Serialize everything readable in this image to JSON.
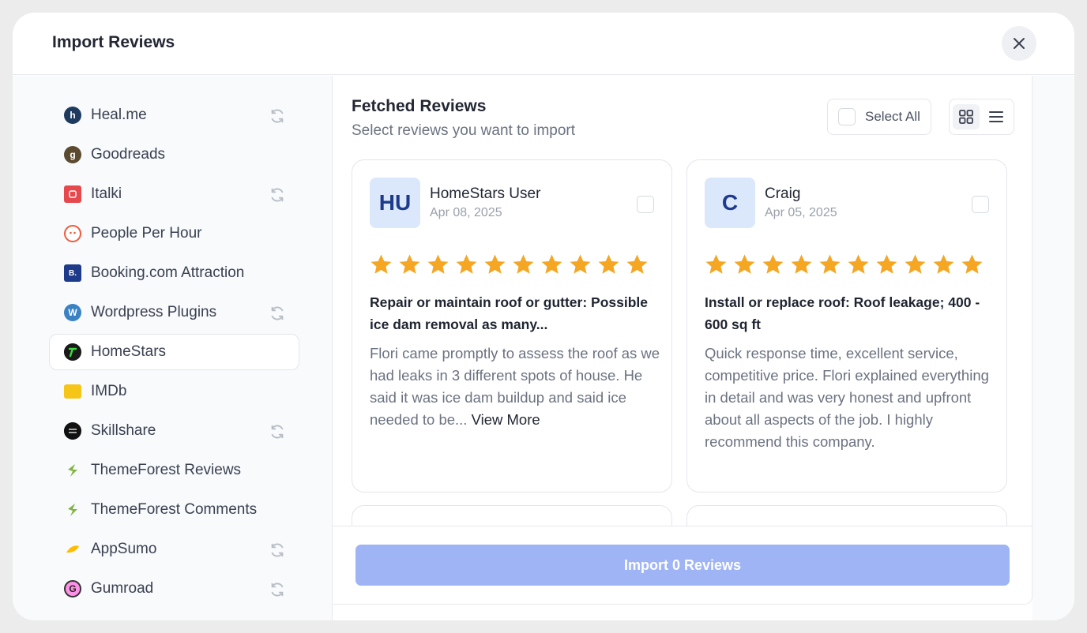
{
  "modal": {
    "title": "Import Reviews"
  },
  "sidebar": {
    "items": [
      {
        "label": "Heal.me",
        "icon": "healme-logo",
        "sync": true,
        "color": "#1e3a5f",
        "glyph": "h"
      },
      {
        "label": "Goodreads",
        "icon": "goodreads-logo",
        "sync": false,
        "color": "#5b4a2f",
        "glyph": "g"
      },
      {
        "label": "Italki",
        "icon": "italki-logo",
        "sync": true,
        "color": "#e5484d",
        "glyph": ""
      },
      {
        "label": "People Per Hour",
        "icon": "peopleperhour-logo",
        "sync": false,
        "color": "#f05a3a",
        "glyph": ""
      },
      {
        "label": "Booking.com Attraction",
        "icon": "booking-logo",
        "sync": false,
        "color": "#1e3a8a",
        "glyph": "B."
      },
      {
        "label": "Wordpress Plugins",
        "icon": "wordpress-logo",
        "sync": true,
        "color": "#3b82c4",
        "glyph": "W"
      },
      {
        "label": "HomeStars",
        "icon": "homestars-logo",
        "sync": false,
        "color": "#1a1a1a",
        "glyph": ""
      },
      {
        "label": "IMDb",
        "icon": "imdb-logo",
        "sync": false,
        "color": "#f5c518",
        "glyph": "IMDb"
      },
      {
        "label": "Skillshare",
        "icon": "skillshare-logo",
        "sync": true,
        "color": "#111111",
        "glyph": ""
      },
      {
        "label": "ThemeForest Reviews",
        "icon": "themeforest-logo",
        "sync": false,
        "color": "#82b440",
        "glyph": ""
      },
      {
        "label": "ThemeForest Comments",
        "icon": "themeforest-logo",
        "sync": false,
        "color": "#82b440",
        "glyph": ""
      },
      {
        "label": "AppSumo",
        "icon": "appsumo-logo",
        "sync": true,
        "color": "#ffbc00",
        "glyph": ""
      },
      {
        "label": "Gumroad",
        "icon": "gumroad-logo",
        "sync": true,
        "color": "#ff90e8",
        "glyph": "G"
      }
    ],
    "active_index": 6
  },
  "main": {
    "title": "Fetched Reviews",
    "subtitle": "Select reviews you want to import",
    "select_all_label": "Select All",
    "view_modes": [
      "grid",
      "list"
    ],
    "active_view": "grid"
  },
  "reviews": [
    {
      "initials": "HU",
      "name": "HomeStars User",
      "date": "Apr 08, 2025",
      "stars": 10,
      "title": "Repair or maintain roof or gutter: Possible ice dam removal as many...",
      "body": "Flori came promptly to assess the roof as we had leaks in 3 different spots of house. He said it was ice dam buildup and said ice needed to be...",
      "view_more": "View More"
    },
    {
      "initials": "C",
      "name": "Craig",
      "date": "Apr 05, 2025",
      "stars": 10,
      "title": "Install or replace roof: Roof leakage; 400 - 600 sq ft",
      "body": "Quick response time, excellent service, competitive price. Flori explained everything in detail and was very honest and upfront about all aspects of the job. I highly recommend this company.",
      "view_more": ""
    }
  ],
  "footer": {
    "import_label": "Import 0 Reviews"
  },
  "colors": {
    "accent": "#9fb4f5",
    "star": "#f5a623",
    "avatar_bg": "#dbe7fb"
  }
}
